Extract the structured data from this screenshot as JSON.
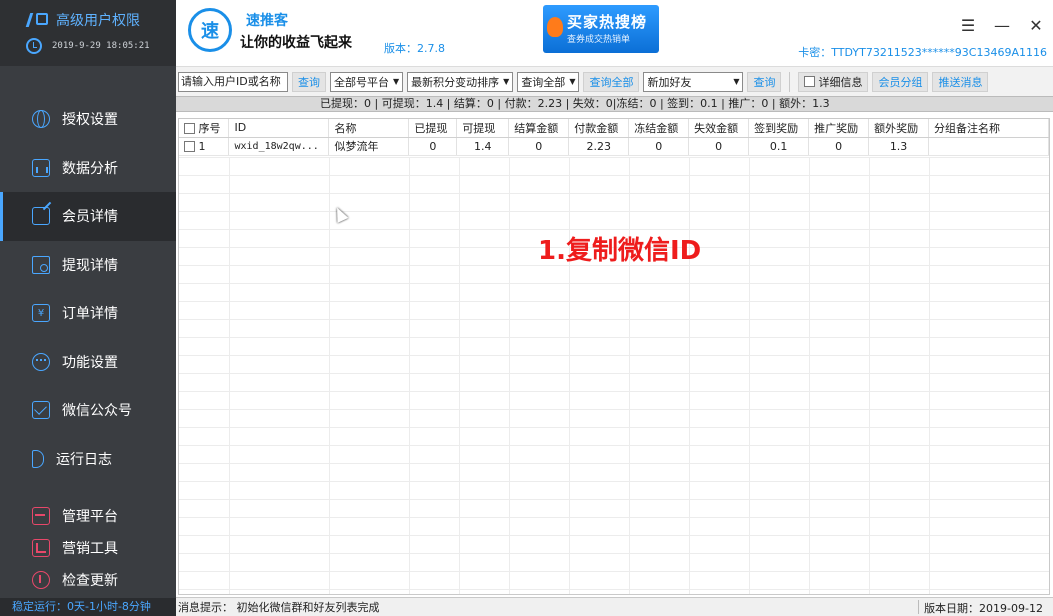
{
  "sidebar": {
    "brand": "高级用户权限",
    "datetime": "2019-9-29 18:05:21",
    "items": [
      {
        "label": "授权设置",
        "icon": "globe-icon"
      },
      {
        "label": "数据分析",
        "icon": "chart-icon"
      },
      {
        "label": "会员详情",
        "icon": "edit-icon"
      },
      {
        "label": "提现详情",
        "icon": "search-icon"
      },
      {
        "label": "订单详情",
        "icon": "yen-icon"
      },
      {
        "label": "功能设置",
        "icon": "wechat-icon"
      },
      {
        "label": "微信公众号",
        "icon": "mail-icon"
      },
      {
        "label": "运行日志",
        "icon": "speaker-icon"
      }
    ],
    "tools": [
      {
        "label": "管理平台",
        "icon": "platform-icon"
      },
      {
        "label": "营销工具",
        "icon": "tools-icon"
      },
      {
        "label": "检查更新",
        "icon": "update-icon"
      }
    ],
    "footer": "稳定运行：0天-1小时-8分钟"
  },
  "header": {
    "logo_char": "速",
    "app_name": "速推客",
    "slogan": "让你的收益飞起来",
    "version": "版本：2.7.8",
    "banner_title": "买家热搜榜",
    "banner_sub": "查券成交热销单",
    "card_id": "卡密：TTDYT73211523******93C13469A1116"
  },
  "toolbar": {
    "search_placeholder": "请输入用户ID或名称",
    "query": "查询",
    "platform": "全部号平台",
    "sort": "最新积分变动排序",
    "filter": "查询全部",
    "query_all": "查询全部",
    "friend": "新加好友",
    "query2": "查询",
    "detail": "详细信息",
    "group": "会员分组",
    "push": "推送消息"
  },
  "summary": "已提现：0 | 可提现：1.4 | 结算：0 | 付款：2.23 | 失效：0|冻结：0 | 签到：0.1 | 推广：0 | 额外：1.3",
  "table": {
    "headers": [
      "序号",
      "ID",
      "名称",
      "已提现",
      "可提现",
      "结算金额",
      "付款金额",
      "冻结金额",
      "失效金额",
      "签到奖励",
      "推广奖励",
      "额外奖励",
      "分组备注名称"
    ],
    "rows": [
      [
        "1",
        "wxid_18w2qw...",
        "似梦流年",
        "0",
        "1.4",
        "0",
        "2.23",
        "0",
        "0",
        "0.1",
        "0",
        "1.3",
        ""
      ]
    ]
  },
  "overlay": "1.复制微信ID",
  "status": {
    "message": "消息提示： 初始化微信群和好友列表完成",
    "date": "版本日期：2019-09-12"
  },
  "colors": {
    "accent": "#1a8fe8",
    "sidebar_bg": "#3a3d41",
    "tool_icon": "#e8486a",
    "overlay": "#ee1c1c"
  }
}
